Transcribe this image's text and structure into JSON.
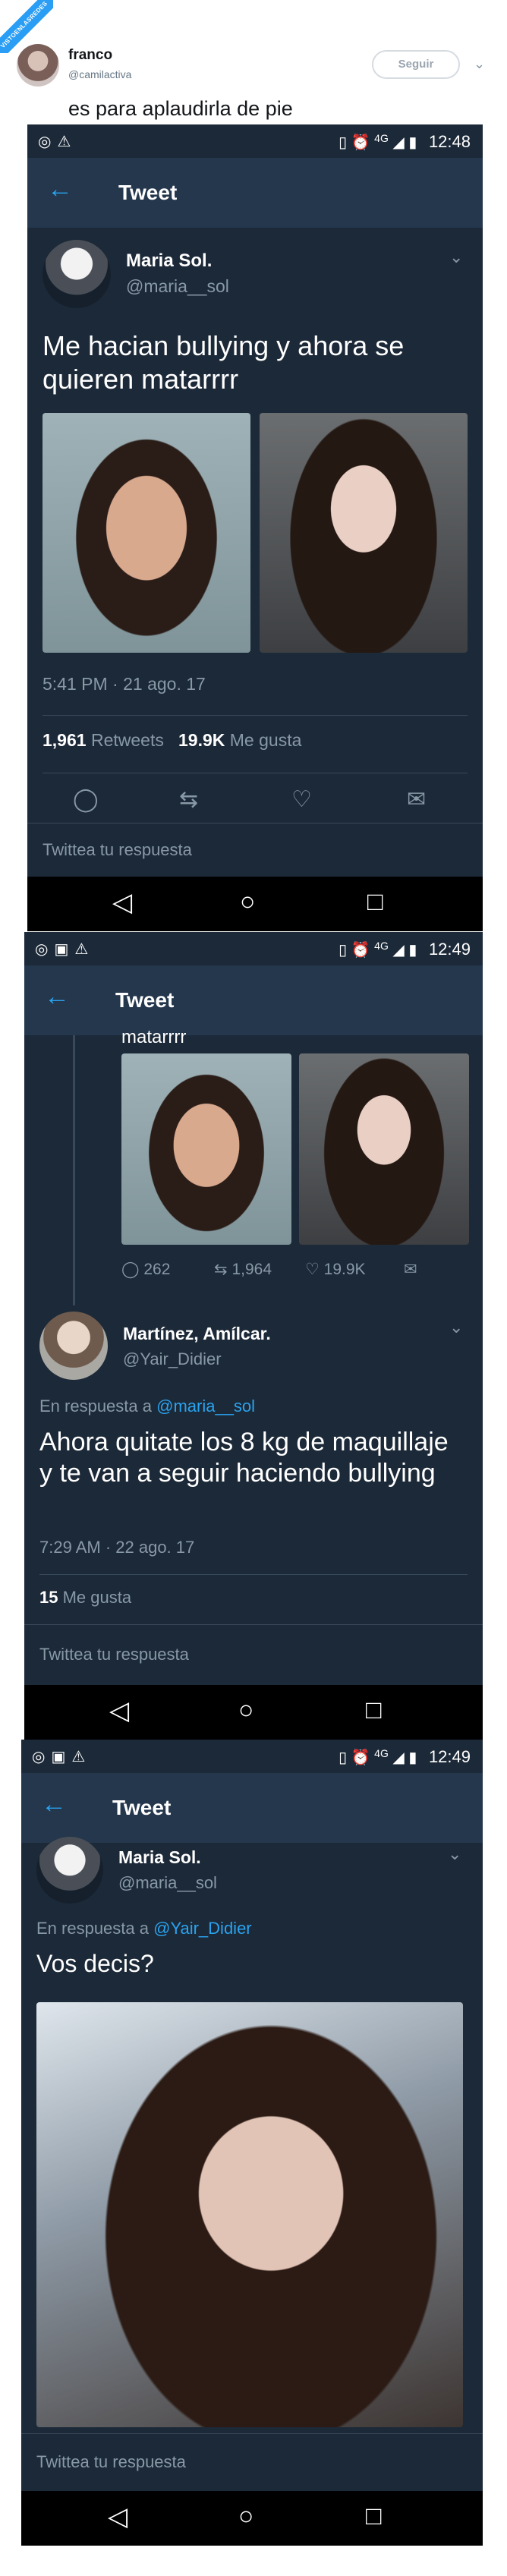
{
  "outer": {
    "badge_text": "VISTOENLASREDES",
    "author_name": "franco",
    "author_handle": "@camilactiva",
    "follow_label": "Seguir",
    "tweet_text": "es para aplaudirla de pie"
  },
  "status1": {
    "time": "12:48",
    "network": "4G"
  },
  "status2": {
    "time": "12:49",
    "network": "4G"
  },
  "status3": {
    "time": "12:49",
    "network": "4G"
  },
  "appbar_title": "Tweet",
  "panel1": {
    "name": "Maria Sol.",
    "handle": "@maria__sol",
    "text": "Me hacian bullying y ahora se quieren matarrrr",
    "timestamp": "5:41 PM · 21 ago. 17",
    "retweets_count": "1,961",
    "retweets_label": "Retweets",
    "likes_count": "19.9K",
    "likes_label": "Me gusta",
    "reply_placeholder": "Twittea tu respuesta"
  },
  "panel2": {
    "quoted_tail": "matarrrr",
    "replies": "262",
    "retweets": "1,964",
    "likes": "19.9K",
    "name": "Martínez, Amílcar.",
    "handle": "@Yair_Didier",
    "reply_prefix": "En respuesta a",
    "reply_mention": "@maria__sol",
    "text": "Ahora quitate los 8 kg de maquillaje y te van a seguir haciendo bullying",
    "timestamp": "7:29 AM · 22 ago. 17",
    "likes_count": "15",
    "likes_label": "Me gusta",
    "reply_placeholder": "Twittea tu respuesta"
  },
  "panel3": {
    "name": "Maria Sol.",
    "handle": "@maria__sol",
    "reply_prefix": "En respuesta a",
    "reply_mention": "@Yair_Didier",
    "text": "Vos decis?",
    "reply_placeholder": "Twittea tu respuesta"
  },
  "icons": {
    "status_left": "whatsapp-icon warning-icon",
    "status_right": "vibrate-icon alarm-icon signal-icon battery-icon",
    "nav": "back-triangle-icon home-circle-icon recents-square-icon"
  },
  "colors": {
    "panel_bg": "#1c2938",
    "appbar_bg": "#24374c",
    "accent": "#2aa3ef"
  }
}
